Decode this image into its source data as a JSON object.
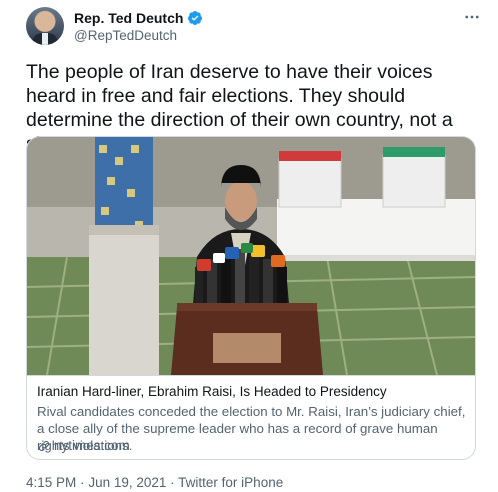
{
  "author": {
    "display_name": "Rep. Ted Deutch",
    "handle": "@RepTedDeutch",
    "verified": true
  },
  "tweet": {
    "text": "The people of Iran deserve to have their voices heard in free and fair elections. They should determine the direction of their own country, not a sham election."
  },
  "card": {
    "title": "Iranian Hard-liner, Ebrahim Raisi, Is Headed to Presidency",
    "description": "Rival candidates conceded the election to Mr. Raisi, Iran’s judiciary chief, a close ally of the supreme leader who has a record of grave human rights violations.",
    "domain": "nytimes.com"
  },
  "meta": {
    "time": "4:15 PM",
    "separator": "·",
    "date": "Jun 19, 2021",
    "source": "Twitter for iPhone"
  },
  "colors": {
    "verified_blue": "#1d9bf0",
    "secondary_text": "#536471",
    "border": "#cfd9de"
  }
}
